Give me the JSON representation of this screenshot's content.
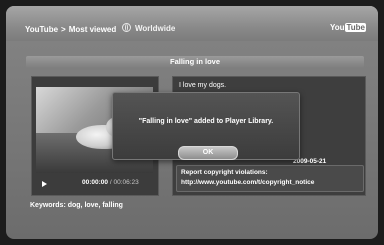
{
  "header": {
    "breadcrumb_root": "YouTube",
    "breadcrumb_separator": ">",
    "breadcrumb_current": "Most viewed",
    "region": "Worldwide",
    "logo_you": "You",
    "logo_tube": "Tube"
  },
  "video": {
    "title": "Falling in love",
    "current_time": "00:00:00",
    "time_separator": " / ",
    "total_time": "00:06:23"
  },
  "info": {
    "description": "I love my dogs.",
    "date": "2009-05-21",
    "copyright_label": "Report copyright violations:",
    "copyright_url": "http://www.youtube.com/t/copyright_notice"
  },
  "keywords": "Keywords: dog, love, falling",
  "dialog": {
    "message": "\"Falling in love\" added to Player Library.",
    "ok_label": "OK"
  },
  "icons": {
    "region": "globe-icon",
    "play": "play-icon"
  }
}
